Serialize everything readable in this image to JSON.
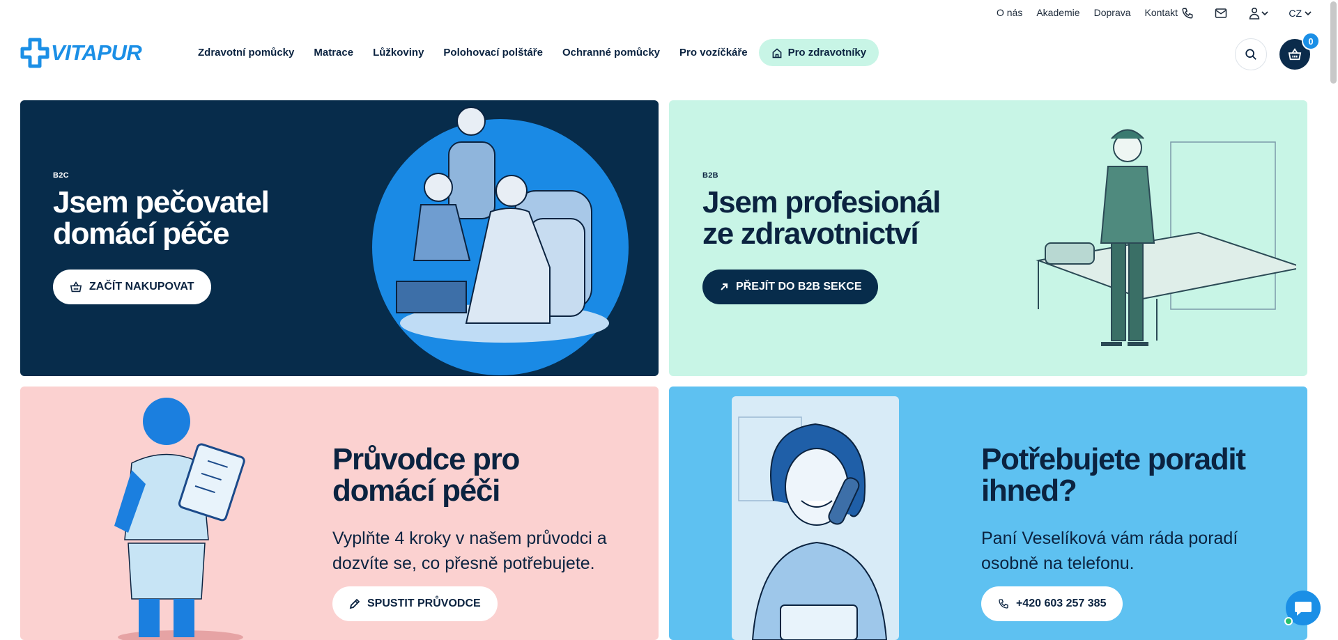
{
  "topbar": {
    "links": [
      "O nás",
      "Akademie",
      "Doprava",
      "Kontakt"
    ],
    "icons": [
      "phone-icon",
      "mail-icon",
      "user-icon"
    ],
    "lang": "CZ"
  },
  "header": {
    "logo_text": "VITAPUR",
    "nav": [
      "Zdravotní pomůcky",
      "Matrace",
      "Lůžkoviny",
      "Polohovací polštáře",
      "Ochranné pomůcky",
      "Pro vozíčkáře"
    ],
    "nav_highlight": "Pro zdravotníky",
    "cart_count": "0"
  },
  "cards": {
    "b2c": {
      "eyebrow": "B2C",
      "title_line1": "Jsem pečovatel",
      "title_line2": "domácí péče",
      "button": "ZAČÍT NAKUPOVAT"
    },
    "b2b": {
      "eyebrow": "B2B",
      "title_line1": "Jsem profesionál",
      "title_line2": "ze zdravotnictví",
      "button": "PŘEJÍT DO B2B SEKCE"
    },
    "guide": {
      "title_line1": "Průvodce pro",
      "title_line2": "domácí péči",
      "desc_line1": "Vyplňte 4 kroky v našem průvodci a",
      "desc_line2": "dozvíte se, co přesně potřebujete.",
      "button": "SPUSTIT PRŮVODCE"
    },
    "advice": {
      "title_line1": "Potřebujete poradit",
      "title_line2": "ihned?",
      "desc_line1": "Paní Veselíková vám ráda poradí",
      "desc_line2": "osobně na telefonu.",
      "button": "+420 603 257 385"
    }
  },
  "colors": {
    "navy": "#072c4b",
    "brand_blue": "#1b8fe6",
    "mint": "#c8f5e6",
    "pink": "#fbd1d0",
    "sky": "#5ec1f1"
  }
}
